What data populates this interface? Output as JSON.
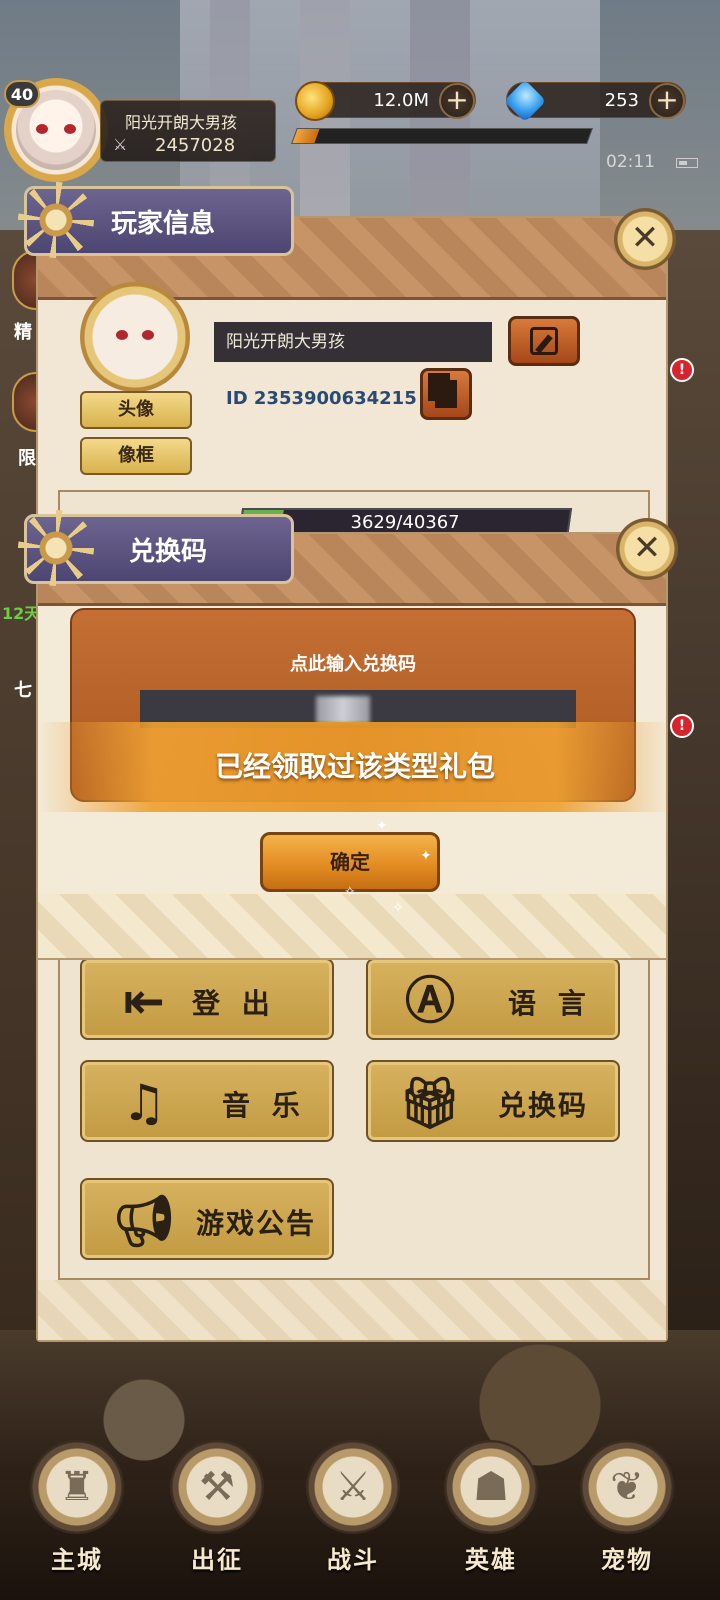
{
  "hud": {
    "level": "40",
    "player_name": "阳光开朗大男孩",
    "power": "2457028",
    "gold": "12.0M",
    "gems": "253",
    "plus": "+",
    "time": "02:11"
  },
  "side": {
    "left_labels": [
      "精",
      "限",
      "12天",
      "七"
    ],
    "badge": "!"
  },
  "player_info": {
    "title": "玩家信息",
    "name_value": "阳光开朗大男孩",
    "id_text": "ID 2353900634215",
    "avatar_button": "头像",
    "frame_button": "像框",
    "progress_text": "3629/40367"
  },
  "redeem": {
    "title": "兑换码",
    "input_title": "点此输入兑换码",
    "toast": "已经领取过该类型礼包",
    "confirm": "确定"
  },
  "settings_buttons": [
    {
      "label": "登 出",
      "icon": "logout-icon"
    },
    {
      "label": "语 言",
      "icon": "language-icon"
    },
    {
      "label": "音 乐",
      "icon": "music-icon"
    },
    {
      "label": "兑换码",
      "icon": "gift-icon"
    },
    {
      "label": "游戏公告",
      "icon": "megaphone-icon"
    }
  ],
  "close_glyph": "✕",
  "bottom_nav": [
    {
      "label": "主城",
      "icon": "castle-icon"
    },
    {
      "label": "出征",
      "icon": "crossed-hammers-icon"
    },
    {
      "label": "战斗",
      "icon": "battle-shield-icon"
    },
    {
      "label": "英雄",
      "icon": "hooded-hero-icon"
    },
    {
      "label": "宠物",
      "icon": "dragon-pet-icon"
    }
  ],
  "colors": {
    "panel_bg": "#f1e7d4",
    "title_tab": "#5c5380",
    "gold_button": "#d7b25f",
    "confirm_button": "#e08a20",
    "toast": "#e6962a"
  }
}
